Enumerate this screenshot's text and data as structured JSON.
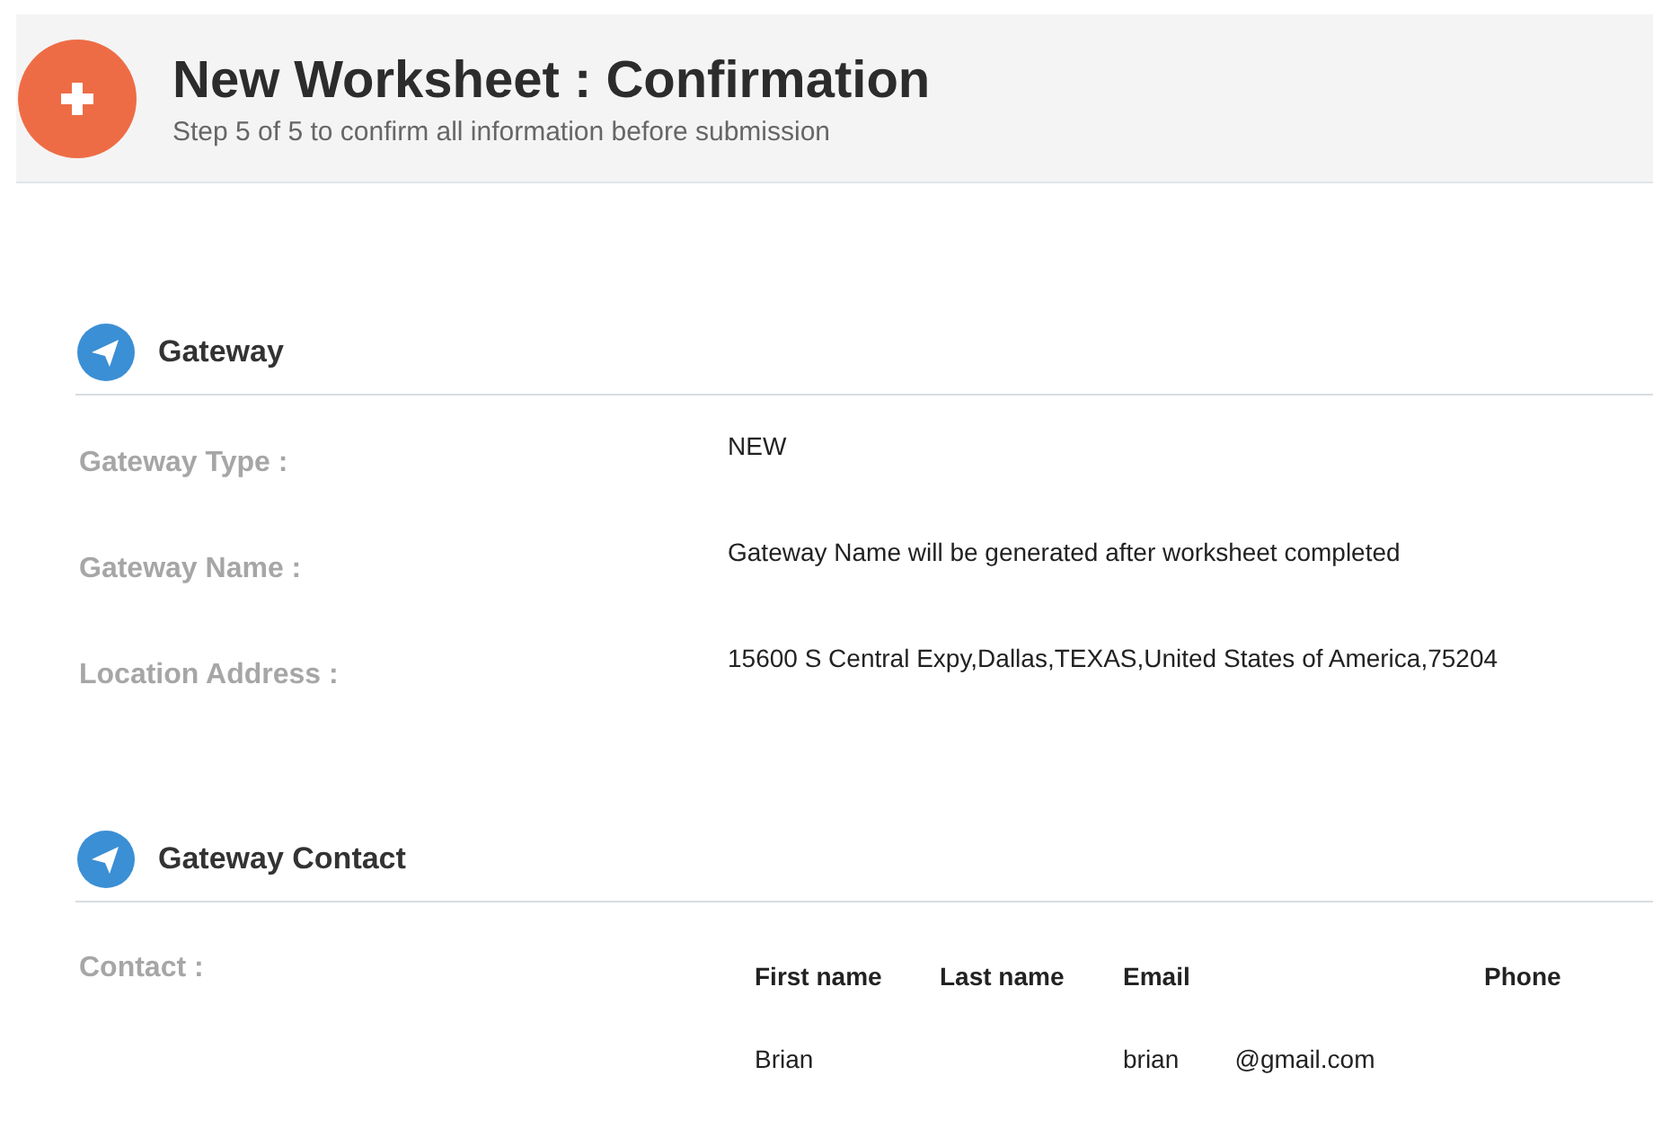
{
  "header": {
    "title": "New Worksheet : Confirmation",
    "subtitle": "Step 5 of 5 to confirm all information before submission"
  },
  "sections": [
    {
      "title": "Gateway",
      "fields": [
        {
          "label": "Gateway Type :",
          "value": "NEW"
        },
        {
          "label": "Gateway Name :",
          "value": "Gateway Name will be generated after worksheet completed"
        },
        {
          "label": "Location Address :",
          "value": "15600 S Central Expy,Dallas,TEXAS,United States of America,75204"
        }
      ]
    },
    {
      "title": "Gateway Contact",
      "contact": {
        "label": "Contact :",
        "columns": [
          "First name",
          "Last name",
          "Email",
          "Phone"
        ],
        "rows": [
          [
            "Brian",
            "",
            "brian        @gmail.com",
            ""
          ]
        ]
      }
    }
  ]
}
